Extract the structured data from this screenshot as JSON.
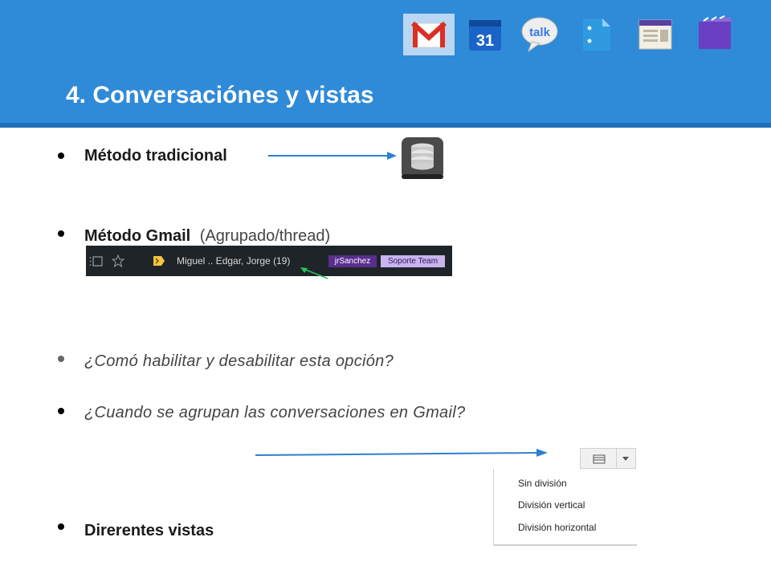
{
  "header": {
    "title": "4. Conversaciónes y vistas",
    "apps": [
      {
        "icon": "gmail-icon",
        "active": true
      },
      {
        "icon": "calendar-icon",
        "label": "31"
      },
      {
        "icon": "talk-icon",
        "label": "talk"
      },
      {
        "icon": "docs-icon"
      },
      {
        "icon": "sites-icon"
      },
      {
        "icon": "video-icon"
      }
    ]
  },
  "bullets": {
    "b1": "Método tradicional",
    "b2_bold": "Método Gmail",
    "b2_plain": "(Agrupado/thread)",
    "b3": "¿Comó habilitar y desabilitar esta opción?",
    "b4": "¿Cuando se agrupan las conversaciones en Gmail?",
    "b5": "Direrentes vistas"
  },
  "conversation_row": {
    "senders": "Miguel .. Edgar, Jorge (19)",
    "labels": [
      "jrSanchez",
      "Soporte Team"
    ]
  },
  "view_menu": {
    "options": [
      "Sin división",
      "División vertical",
      "División horizontal"
    ]
  },
  "colors": {
    "header_blue": "#2f8ad8",
    "arrow_blue": "#2f7fd0",
    "arrow_green": "#22c55e",
    "label_purple": "#5a2e8e",
    "label_lilac": "#c9b4ef"
  }
}
